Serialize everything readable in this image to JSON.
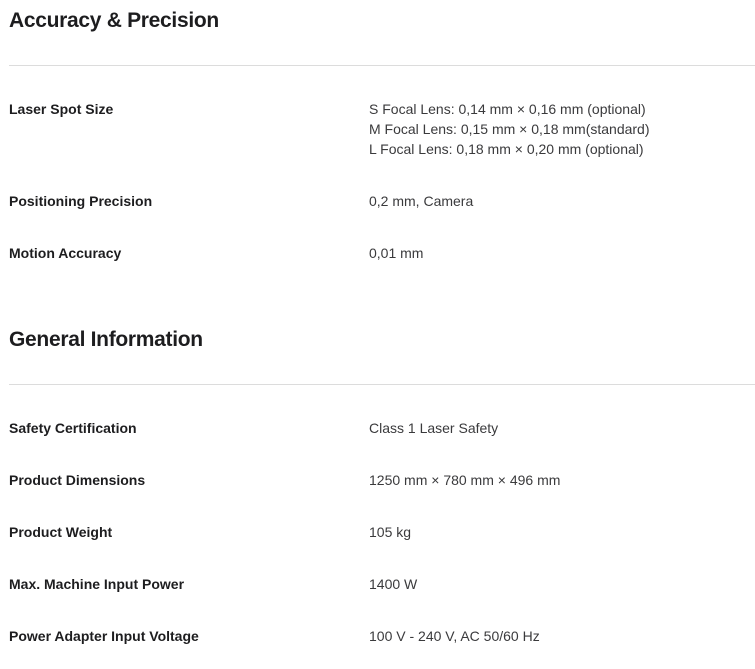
{
  "sections": [
    {
      "title": "Accuracy & Precision",
      "rows": [
        {
          "label": "Laser Spot Size",
          "lines": [
            "S Focal Lens: 0,14 mm × 0,16 mm (optional)",
            "M Focal Lens: 0,15 mm × 0,18 mm(standard)",
            "L Focal Lens: 0,18 mm × 0,20 mm (optional)"
          ]
        },
        {
          "label": "Positioning Precision",
          "lines": [
            "0,2 mm, Camera"
          ]
        },
        {
          "label": "Motion Accuracy",
          "lines": [
            "0,01 mm"
          ]
        }
      ]
    },
    {
      "title": "General Information",
      "rows": [
        {
          "label": "Safety Certification",
          "lines": [
            "Class 1 Laser Safety"
          ]
        },
        {
          "label": "Product Dimensions",
          "lines": [
            "1250 mm × 780 mm × 496 mm"
          ]
        },
        {
          "label": "Product Weight",
          "lines": [
            "105 kg"
          ]
        },
        {
          "label": "Max. Machine Input Power",
          "lines": [
            "1400 W"
          ]
        },
        {
          "label": "Power Adapter Input Voltage",
          "lines": [
            "100 V - 240 V, AC 50/60 Hz"
          ]
        }
      ]
    }
  ]
}
